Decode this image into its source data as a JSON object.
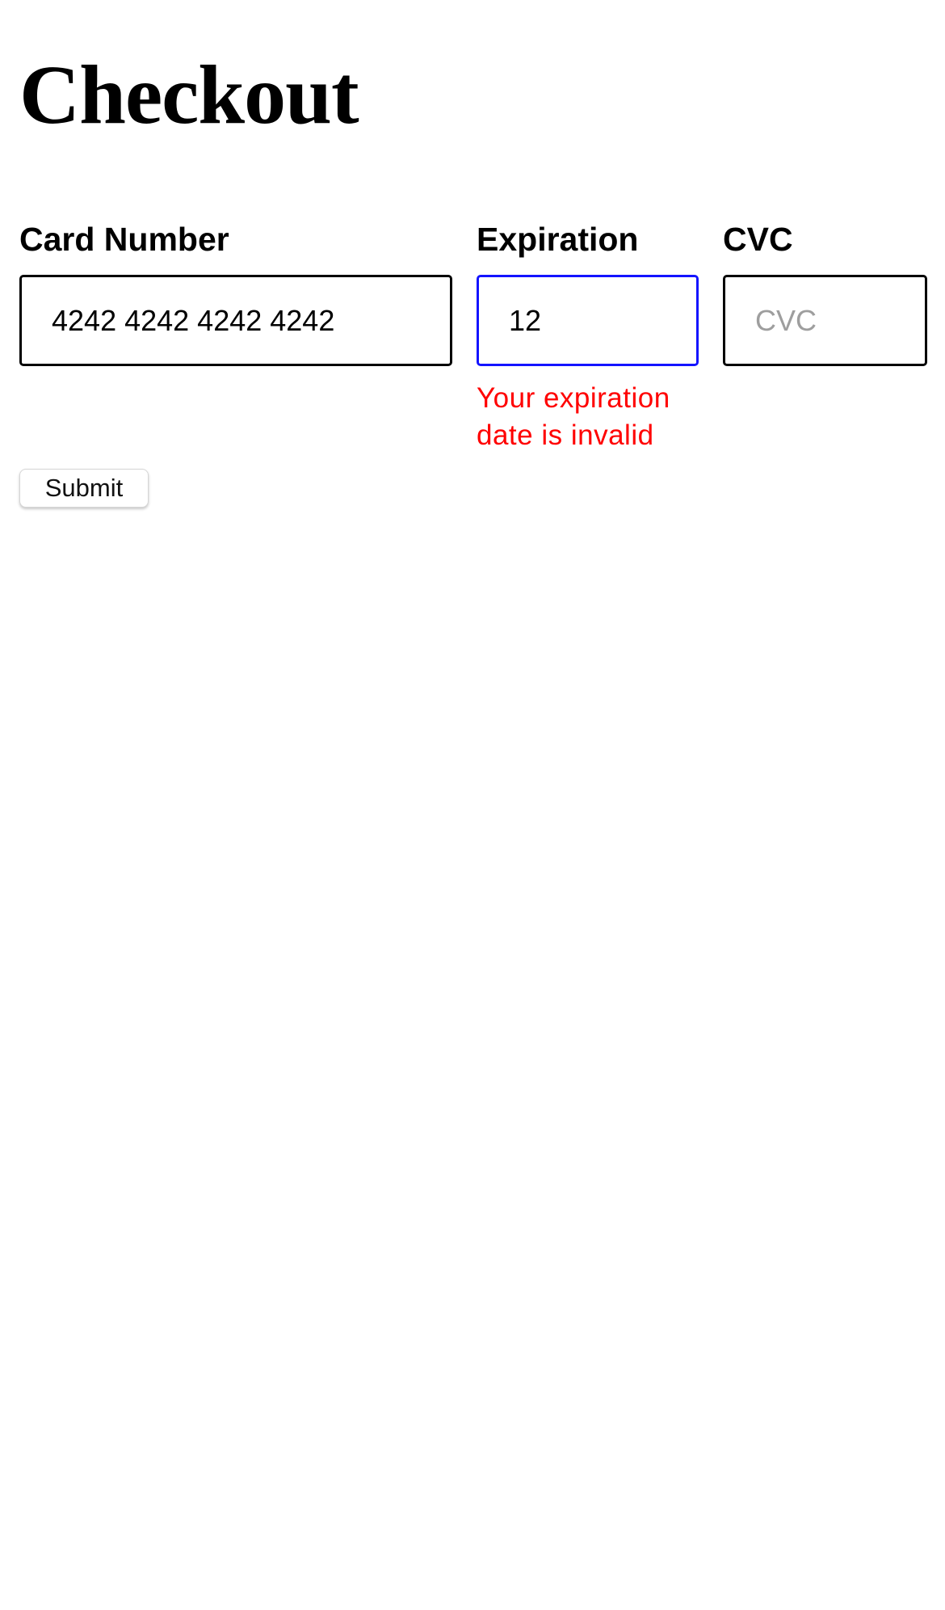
{
  "page": {
    "title": "Checkout"
  },
  "form": {
    "card_number": {
      "label": "Card Number",
      "value": "4242 4242 4242 4242",
      "placeholder": ""
    },
    "expiration": {
      "label": "Expiration",
      "value": "12",
      "placeholder": "",
      "error": "Your expiration date is invalid"
    },
    "cvc": {
      "label": "CVC",
      "value": "",
      "placeholder": "CVC"
    },
    "submit_label": "Submit"
  },
  "colors": {
    "focus_border": "#1414ff",
    "error": "#ff0000",
    "placeholder": "#9e9e9e"
  }
}
